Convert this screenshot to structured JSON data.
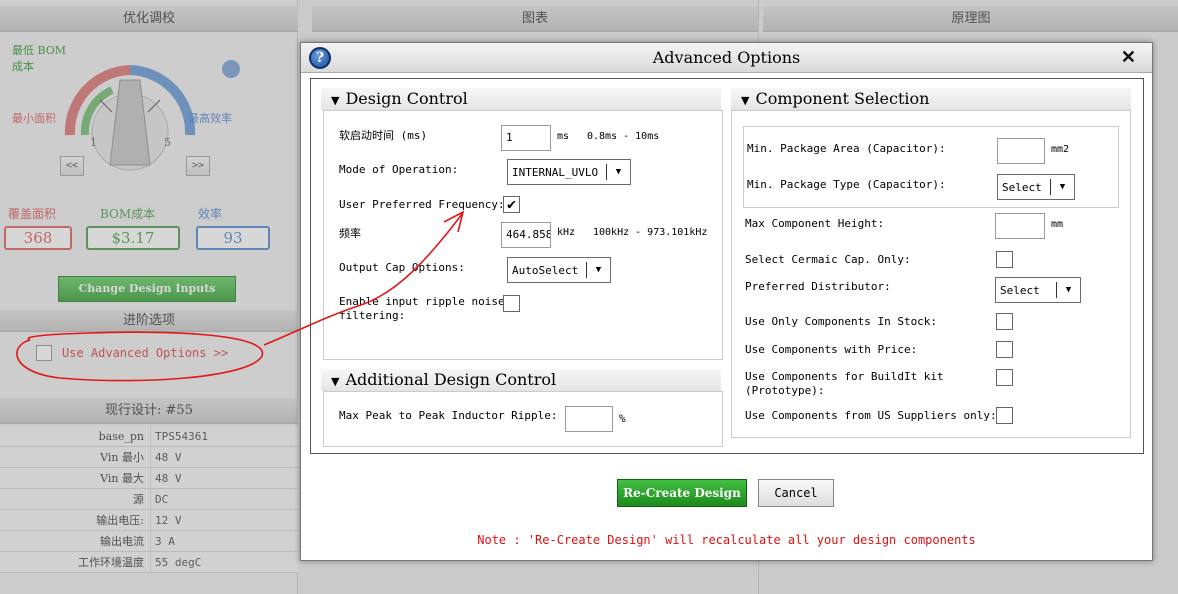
{
  "background": {
    "left_header": "优化调校",
    "mid_header": "图表",
    "right_header": "原理图",
    "dial": {
      "lowest_bom_label": "最低 BOM 成本",
      "min_area_label": "最小面积",
      "max_eff_label": "最高效率",
      "tick_1": "1",
      "tick_5": "5",
      "prev_btn": "<<",
      "next_btn": ">>"
    },
    "metrics": [
      {
        "label": "覆盖面积",
        "value": "368",
        "color": "#e06666"
      },
      {
        "label": "BOM成本",
        "value": "$3.17",
        "color": "#55a055"
      },
      {
        "label": "效率",
        "value": "93",
        "color": "#5a8fd0"
      }
    ],
    "change_inputs_btn": "Change Design Inputs",
    "advanced_section": "进阶选项",
    "use_advanced_options": "Use Advanced Options >>",
    "current_design": "现行设计: #55",
    "info_rows": [
      {
        "k": "base_pn",
        "v": "TPS54361"
      },
      {
        "k": "Vin 最小",
        "v": "48 V"
      },
      {
        "k": "Vin 最大",
        "v": "48 V"
      },
      {
        "k": "源",
        "v": "DC"
      },
      {
        "k": "输出电压:",
        "v": "12 V"
      },
      {
        "k": "输出电流",
        "v": "3 A"
      },
      {
        "k": "工作环境温度",
        "v": "55 degC"
      }
    ]
  },
  "dialog": {
    "title": "Advanced Options",
    "close_symbol": "✕",
    "help_symbol": "?",
    "design_control": {
      "header": "Design Control",
      "soft_start_label": "软启动时间 (ms)",
      "soft_start_value": "1",
      "soft_start_unit": "ms",
      "soft_start_range": "0.8ms - 10ms",
      "mode_label": "Mode of Operation:",
      "mode_value": "INTERNAL_UVLO",
      "user_freq_label": "User Preferred Frequency:",
      "user_freq_checked": "✔",
      "freq_label": "频率",
      "freq_value": "464.858",
      "freq_unit": "kHz",
      "freq_range": "100kHz - 973.101kHz",
      "output_cap_label": "Output Cap Options:",
      "output_cap_value": "AutoSelect",
      "ripple_label_1": "Enable input ripple noise",
      "ripple_label_2": "filtering:"
    },
    "additional_control": {
      "header": "Additional Design Control",
      "ripple_label": "Max Peak to Peak Inductor Ripple:",
      "ripple_unit": "%"
    },
    "component_selection": {
      "header": "Component Selection",
      "pkg_area_label": "Min. Package Area (Capacitor):",
      "pkg_area_unit": "mm2",
      "pkg_type_label": "Min. Package Type (Capacitor):",
      "pkg_type_value": "Select",
      "max_height_label": "Max Component Height:",
      "max_height_unit": "mm",
      "ceramic_label": "Select Cermaic Cap. Only:",
      "distributor_label": "Preferred Distributor:",
      "distributor_value": "Select",
      "in_stock_label": "Use Only Components In Stock:",
      "with_price_label": "Use Components with Price:",
      "buildit_label_1": "Use Components for BuildIt kit",
      "buildit_label_2": "(Prototype):",
      "us_suppliers_label": "Use Components from US Suppliers only:"
    },
    "recreate_btn": "Re-Create Design",
    "cancel_btn": "Cancel",
    "note": "Note : 'Re-Create Design' will recalculate all your design components"
  }
}
